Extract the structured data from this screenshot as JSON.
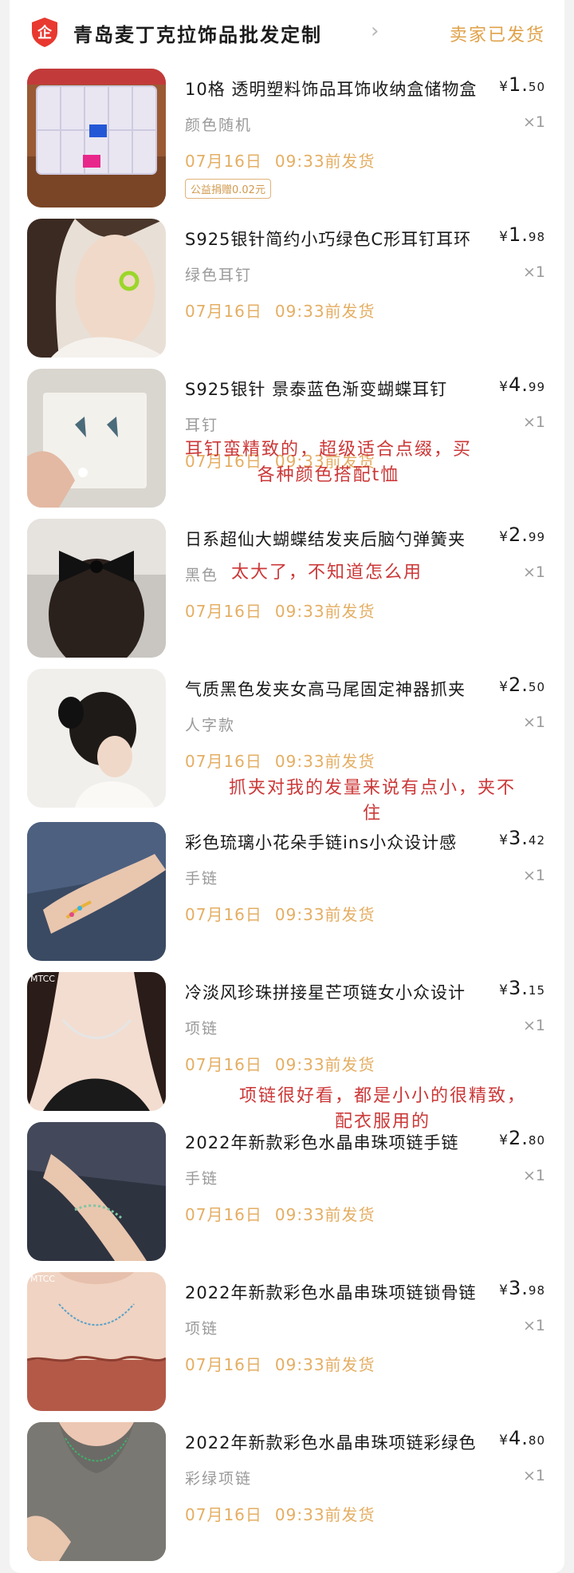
{
  "shop": {
    "name": "青岛麦丁克拉饰品批发定制",
    "arrow": "›",
    "status": "卖家已发货",
    "badge_color": "#e8382f"
  },
  "currency": "¥",
  "items": [
    {
      "title": "10格 透明塑料饰品耳饰收纳盒储物盒",
      "price_int": "1.",
      "price_dec": "50",
      "variant": "颜色随机",
      "qty": "×1",
      "ship_date": "07月16日",
      "ship_time": "09:33前发货",
      "badge": "公益捐赠0.02元"
    },
    {
      "title": "S925银针简约小巧绿色C形耳钉耳环",
      "price_int": "1.",
      "price_dec": "98",
      "variant": "绿色耳钉",
      "qty": "×1",
      "ship_date": "07月16日",
      "ship_time": "09:33前发货"
    },
    {
      "title": "S925银针 景泰蓝色渐变蝴蝶耳钉",
      "price_int": "4.",
      "price_dec": "99",
      "variant": "耳钉",
      "qty": "×1",
      "ship_date": "07月16日",
      "ship_time": "09:33前发货"
    },
    {
      "title": "日系超仙大蝴蝶结发夹后脑勺弹簧夹",
      "price_int": "2.",
      "price_dec": "99",
      "variant": "黑色",
      "qty": "×1",
      "ship_date": "07月16日",
      "ship_time": "09:33前发货"
    },
    {
      "title": "气质黑色发夹女高马尾固定神器抓夹",
      "price_int": "2.",
      "price_dec": "50",
      "variant": "人字款",
      "qty": "×1",
      "ship_date": "07月16日",
      "ship_time": "09:33前发货"
    },
    {
      "title": "彩色琉璃小花朵手链ins小众设计感",
      "price_int": "3.",
      "price_dec": "42",
      "variant": "手链",
      "qty": "×1",
      "ship_date": "07月16日",
      "ship_time": "09:33前发货"
    },
    {
      "title": "冷淡风珍珠拼接星芒项链女小众设计",
      "price_int": "3.",
      "price_dec": "15",
      "variant": "项链",
      "qty": "×1",
      "ship_date": "07月16日",
      "ship_time": "09:33前发货",
      "watermark": "MTCC"
    },
    {
      "title": "2022年新款彩色水晶串珠项链手链",
      "price_int": "2.",
      "price_dec": "80",
      "variant": "手链",
      "qty": "×1",
      "ship_date": "07月16日",
      "ship_time": "09:33前发货"
    },
    {
      "title": "2022年新款彩色水晶串珠项链锁骨链",
      "price_int": "3.",
      "price_dec": "98",
      "variant": "项链",
      "qty": "×1",
      "ship_date": "07月16日",
      "ship_time": "09:33前发货",
      "watermark": "MTCC"
    },
    {
      "title": "2022年新款彩色水晶串珠项链彩绿色",
      "price_int": "4.",
      "price_dec": "80",
      "variant": "彩绿项链",
      "qty": "×1",
      "ship_date": "07月16日",
      "ship_time": "09:33前发货"
    }
  ],
  "notes": {
    "earring": [
      "耳钉蛮精致的，超级适合点缀，买",
      "各种颜色搭配t恤"
    ],
    "bow": "太大了，不知道怎么用",
    "claw": [
      "抓夹对我的发量来说有点小，夹不",
      "住"
    ],
    "necklace": [
      "项链很好看，都是小小的很精致，",
      "配衣服用的"
    ]
  }
}
